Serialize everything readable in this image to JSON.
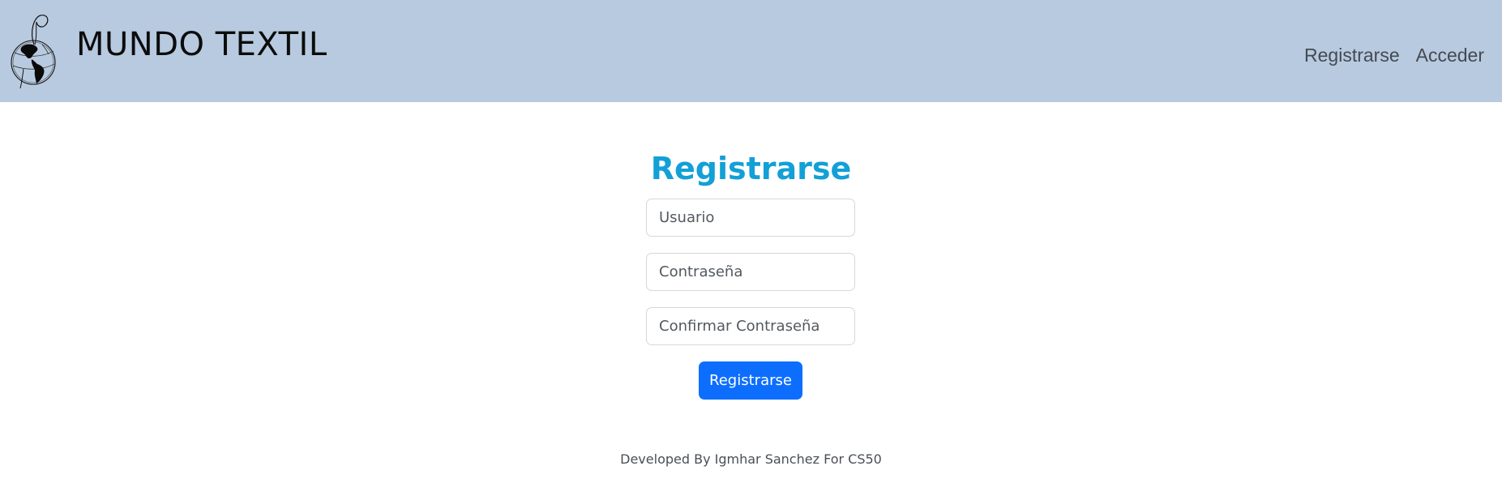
{
  "header": {
    "brand_name": "MUNDO TEXTIL",
    "logo_icon": "globe-thread-icon",
    "background_color": "#b8cadf",
    "nav": [
      {
        "label": "Registrarse"
      },
      {
        "label": "Acceder"
      }
    ]
  },
  "form": {
    "title": "Registrarse",
    "title_color": "#12a0d7",
    "username": {
      "value": "",
      "placeholder": "Usuario"
    },
    "password": {
      "value": "",
      "placeholder": "Contraseña"
    },
    "confirm_password": {
      "value": "",
      "placeholder": "Confirmar Contraseña"
    },
    "submit_label": "Registrarse",
    "submit_color": "#0d6efd"
  },
  "footer": {
    "text": "Developed By Igmhar Sanchez For CS50"
  }
}
